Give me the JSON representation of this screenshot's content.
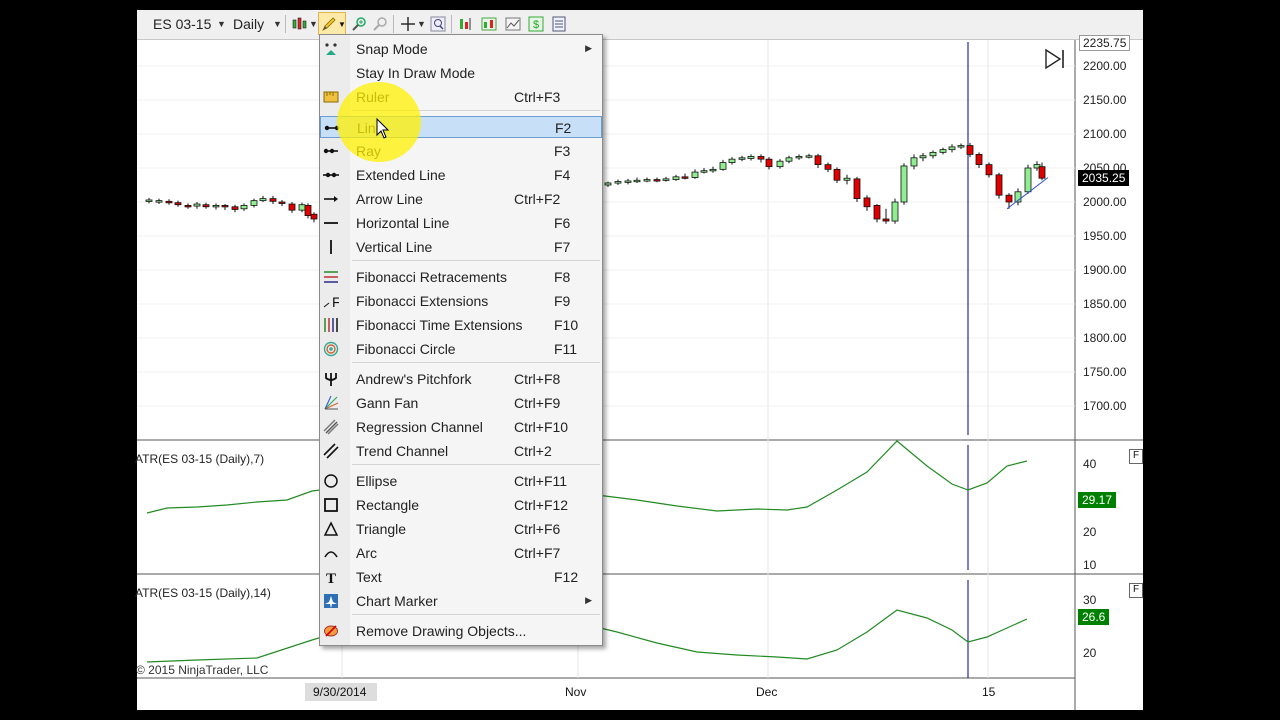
{
  "toolbar": {
    "instrument": "ES 03-15",
    "period": "Daily",
    "icons": [
      "bars-type-icon",
      "pencil-draw-icon",
      "zoom-in-icon",
      "zoom-out-icon",
      "crosshair-icon",
      "magnify-icon",
      "chart-add-icon",
      "data-box-icon",
      "strategy-icon",
      "dollar-icon",
      "properties-icon"
    ]
  },
  "price_axis": {
    "top_value": "2235.75",
    "ticks": [
      "2200.00",
      "2150.00",
      "2100.00",
      "2050.00",
      "2000.00",
      "1950.00",
      "1900.00",
      "1850.00",
      "1800.00",
      "1750.00",
      "1700.00"
    ],
    "current_price": "2035.25",
    "current_color": "#000000"
  },
  "indicators": [
    {
      "label": "ATR(ES 03-15 (Daily),7)",
      "ticks": [
        "40",
        "20",
        "10"
      ],
      "value": "29.17",
      "color": "#008000"
    },
    {
      "label": "ATR(ES 03-15 (Daily),14)",
      "ticks": [
        "30",
        "20"
      ],
      "value": "26.6",
      "color": "#008000"
    }
  ],
  "x_axis": {
    "labels": [
      "9/30/2014",
      "Nov",
      "Dec",
      "15"
    ]
  },
  "copyright": "© 2015 NinjaTrader, LLC",
  "pane_flag": "F",
  "candle_colors": {
    "up": "#90ee90",
    "down": "#e00000",
    "line": "#228b22",
    "marker": "#00008b"
  },
  "menu": {
    "items": [
      {
        "label": "Snap Mode",
        "shortcut": "",
        "icon": "snap-mode-icon",
        "submenu": true
      },
      {
        "label": "Stay In Draw Mode",
        "shortcut": "",
        "icon": ""
      },
      {
        "label": "Ruler",
        "shortcut": "Ctrl+F3",
        "icon": "ruler-icon"
      },
      {
        "label": "Line",
        "shortcut": "F2",
        "icon": "line-icon",
        "highlighted": true
      },
      {
        "label": "Ray",
        "shortcut": "F3",
        "icon": "ray-icon"
      },
      {
        "label": "Extended Line",
        "shortcut": "F4",
        "icon": "extended-line-icon"
      },
      {
        "label": "Arrow Line",
        "shortcut": "Ctrl+F2",
        "icon": "arrow-line-icon"
      },
      {
        "label": "Horizontal Line",
        "shortcut": "F6",
        "icon": "horizontal-line-icon"
      },
      {
        "label": "Vertical Line",
        "shortcut": "F7",
        "icon": "vertical-line-icon"
      },
      {
        "label": "Fibonacci Retracements",
        "shortcut": "F8",
        "icon": "fibonacci-retracements-icon"
      },
      {
        "label": "Fibonacci Extensions",
        "shortcut": "F9",
        "icon": "fibonacci-extensions-icon"
      },
      {
        "label": "Fibonacci Time Extensions",
        "shortcut": "F10",
        "icon": "fibonacci-time-extensions-icon"
      },
      {
        "label": "Fibonacci Circle",
        "shortcut": "F11",
        "icon": "fibonacci-circle-icon"
      },
      {
        "label": "Andrew's Pitchfork",
        "shortcut": "Ctrl+F8",
        "icon": "pitchfork-icon"
      },
      {
        "label": "Gann Fan",
        "shortcut": "Ctrl+F9",
        "icon": "gann-fan-icon"
      },
      {
        "label": "Regression Channel",
        "shortcut": "Ctrl+F10",
        "icon": "regression-channel-icon"
      },
      {
        "label": "Trend Channel",
        "shortcut": "Ctrl+2",
        "icon": "trend-channel-icon"
      },
      {
        "label": "Ellipse",
        "shortcut": "Ctrl+F11",
        "icon": "ellipse-icon"
      },
      {
        "label": "Rectangle",
        "shortcut": "Ctrl+F12",
        "icon": "rectangle-icon"
      },
      {
        "label": "Triangle",
        "shortcut": "Ctrl+F6",
        "icon": "triangle-icon"
      },
      {
        "label": "Arc",
        "shortcut": "Ctrl+F7",
        "icon": "arc-icon"
      },
      {
        "label": "Text",
        "shortcut": "F12",
        "icon": "text-icon"
      },
      {
        "label": "Chart Marker",
        "shortcut": "",
        "icon": "chart-marker-icon",
        "submenu": true
      },
      {
        "label": "Remove Drawing Objects...",
        "shortcut": "",
        "icon": "remove-drawing-icon"
      }
    ]
  }
}
